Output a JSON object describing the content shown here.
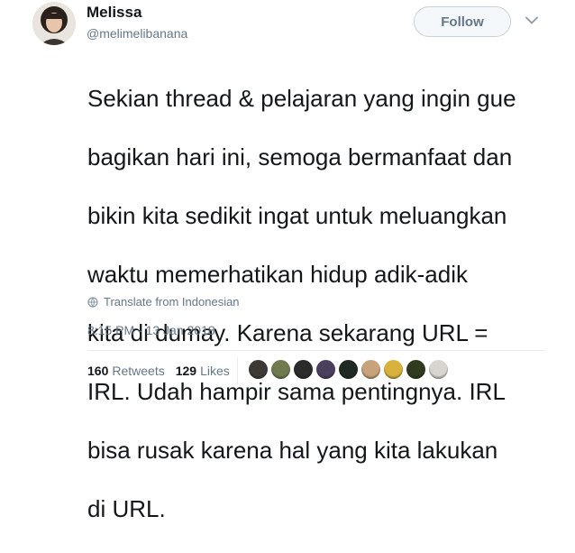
{
  "user": {
    "name": "Melissa",
    "handle": "@melimelibanana"
  },
  "actions": {
    "follow_label": "Follow"
  },
  "tweet": {
    "lines": [
      "Sekian thread & pelajaran yang ingin gue",
      "bagikan hari ini, semoga bermanfaat dan",
      "bikin kita sedikit ingat untuk meluangkan",
      "waktu memerhatikan hidup adik-adik",
      "kita di dumay. Karena sekarang URL =",
      "IRL. Udah hampir sama pentingnya. IRL",
      "bisa rusak karena hal yang kita lakukan",
      "di URL."
    ],
    "translate_label": "Translate from Indonesian",
    "timestamp": "8:15 PM - 13 Jan 2018"
  },
  "stats": {
    "retweets_count": "160",
    "retweets_label": "Retweets",
    "likes_count": "129",
    "likes_label": "Likes"
  },
  "likers": [
    {
      "color": "#3d3a36"
    },
    {
      "color": "#6f7a4e"
    },
    {
      "color": "#2b2b2b"
    },
    {
      "color": "#4a3f5c"
    },
    {
      "color": "#1f2a22"
    },
    {
      "color": "#c7a27a"
    },
    {
      "color": "#d9b23d"
    },
    {
      "color": "#2f3a1e"
    },
    {
      "color": "#d8d4d0"
    }
  ],
  "colors": {
    "text": "#14171a",
    "secondary": "#657786",
    "divider": "#e6ecf0"
  }
}
